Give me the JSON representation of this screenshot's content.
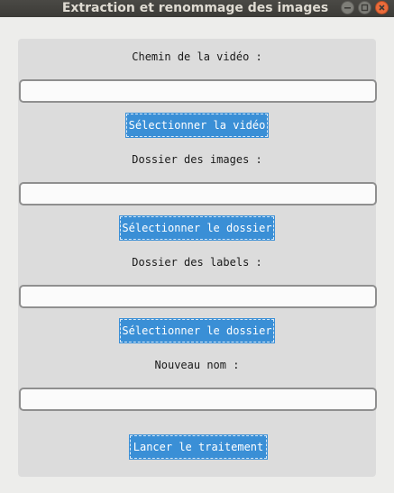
{
  "window": {
    "title": "Extraction et renommage des images",
    "controls": [
      "minimize-icon",
      "maximize-icon",
      "close-icon"
    ]
  },
  "form": {
    "video_label": "Chemin de la vidéo :",
    "video_value": "",
    "video_button": "Sélectionner la vidéo",
    "images_label": "Dossier des images :",
    "images_value": "",
    "images_button": "Sélectionner le dossier",
    "labels_label": "Dossier des labels :",
    "labels_value": "",
    "labels_button": "Sélectionner le dossier",
    "name_label": "Nouveau nom :",
    "name_value": "",
    "run_button": "Lancer le traitement"
  },
  "colors": {
    "accent": "#3a8fd6",
    "panel": "#dcdcdc",
    "titlebar": "#3c3b37"
  }
}
